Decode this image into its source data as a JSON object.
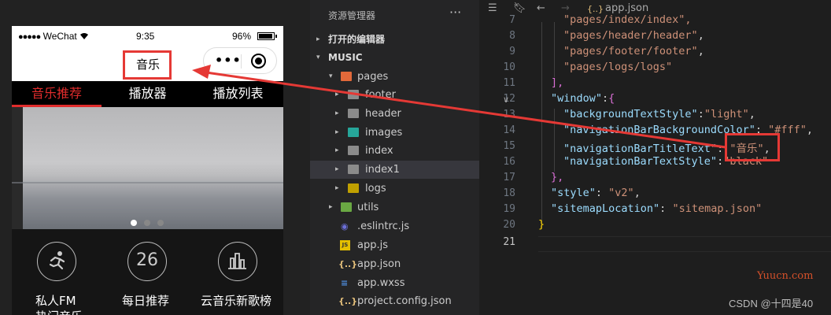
{
  "phone": {
    "carrier": "WeChat",
    "signal_dots": "●●●●●",
    "wifi_icon": "wifi-icon",
    "time": "9:35",
    "battery": "96%",
    "nav_title": "音乐",
    "capsule_more": "•••",
    "tabs": [
      "音乐推荐",
      "播放器",
      "播放列表"
    ],
    "active_tab": 0,
    "swiper_dots": 3,
    "swiper_active": 0,
    "quick_items": [
      {
        "label": "私人FM",
        "icon": "runner-icon"
      },
      {
        "label": "每日推荐",
        "icon_text": "26"
      },
      {
        "label": "云音乐新歌榜",
        "icon": "chart-icon"
      }
    ],
    "quick_partial": "热门音乐"
  },
  "explorer": {
    "title": "资源管理器",
    "more": "···",
    "open_editors": "打开的编辑器",
    "project": "MUSIC",
    "items": [
      {
        "name": "pages",
        "icon": "folder-red",
        "arrow": "▾"
      },
      {
        "name": "footer",
        "icon": "folder",
        "arrow": "▸"
      },
      {
        "name": "header",
        "icon": "folder",
        "arrow": "▸"
      },
      {
        "name": "images",
        "icon": "folder-teal",
        "arrow": "▸"
      },
      {
        "name": "index",
        "icon": "folder",
        "arrow": "▸"
      },
      {
        "name": "index1",
        "icon": "folder",
        "arrow": "▸"
      },
      {
        "name": "logs",
        "icon": "folder-yellow",
        "arrow": "▸"
      },
      {
        "name": "utils",
        "icon": "folder-green",
        "arrow": "▸"
      },
      {
        "name": ".eslintrc.js",
        "icon": "eslint-icon"
      },
      {
        "name": "app.js",
        "icon": "js-icon"
      },
      {
        "name": "app.json",
        "icon": "json-icon"
      },
      {
        "name": "app.wxss",
        "icon": "css-icon"
      },
      {
        "name": "project.config.json",
        "icon": "json-icon"
      }
    ]
  },
  "editor": {
    "breadcrumb_icon": "{..}",
    "breadcrumb": "app.json",
    "line_numbers": [
      "7",
      "8",
      "9",
      "10",
      "11",
      "12",
      "13",
      "14",
      "15",
      "16",
      "17",
      "18",
      "19",
      "20",
      "21"
    ],
    "lines": {
      "l7": "\"pages/index/index\",",
      "l8_str": "\"pages/header/header\"",
      "l9_str": "\"pages/footer/footer\"",
      "l10_str": "\"pages/logs/logs\"",
      "l11": "],",
      "l12_key": "\"window\"",
      "l13_key": "\"backgroundTextStyle\"",
      "l13_val": "\"light\"",
      "l14_key": "\"navigationBarBackgroundColor\"",
      "l14_val": "\"#fff\"",
      "l15_key": "\"navigationBarTitleText\"",
      "l15_val": "\"音乐\"",
      "l16_key": "\"navigationBarTextStyle\"",
      "l16_val": "\"black\"",
      "l17": "},",
      "l18_key": "\"style\"",
      "l18_val": "\"v2\"",
      "l19_key": "\"sitemapLocation\"",
      "l19_val": "\"sitemap.json\"",
      "l20": "}"
    }
  },
  "watermarks": {
    "site": "Yuucn.com",
    "csdn": "CSDN @十四是40"
  },
  "colors": {
    "accent_red": "#e02c2c",
    "annotation_red": "#e53935",
    "editor_bg": "#1e1e1e",
    "explorer_bg": "#252526"
  }
}
